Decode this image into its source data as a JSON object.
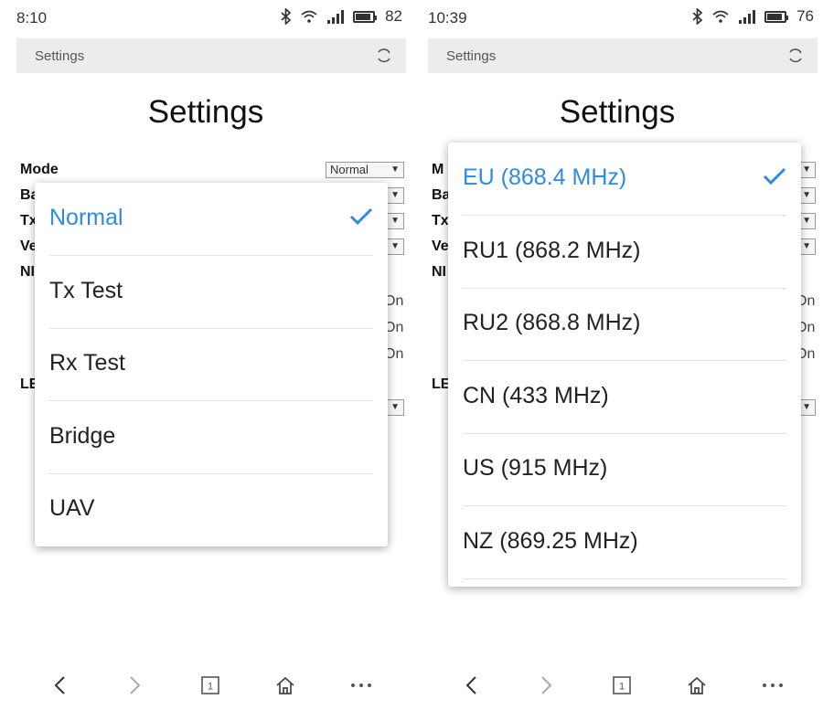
{
  "screens": [
    {
      "time": "8:10",
      "battery": "82",
      "address_title": "Settings",
      "page_title": "Settings",
      "labels": [
        "Mode",
        "Ba",
        "Tx",
        "Ve",
        "NI",
        "LE"
      ],
      "mode_select": "Normal",
      "right_fragments": [
        "On",
        "On",
        "On"
      ],
      "dropdown": {
        "options": [
          "Normal",
          "Tx Test",
          "Rx Test",
          "Bridge",
          "UAV"
        ],
        "selected": "Normal"
      }
    },
    {
      "time": "10:39",
      "battery": "76",
      "address_title": "Settings",
      "page_title": "Settings",
      "labels": [
        "M",
        "Ba",
        "Tx",
        "Ve",
        "NI",
        "LE"
      ],
      "right_fragments": [
        "On",
        "On",
        "On"
      ],
      "dropdown": {
        "options": [
          "EU (868.4 MHz)",
          "RU1 (868.2 MHz)",
          "RU2 (868.8 MHz)",
          "CN (433 MHz)",
          "US (915 MHz)",
          "NZ (869.25 MHz)"
        ],
        "selected": "EU (868.4 MHz)"
      }
    }
  ],
  "colors": {
    "accent": "#2e8be0",
    "text": "#222222",
    "address_bg": "#ececec"
  },
  "icons": [
    "bluetooth-icon",
    "wifi-icon",
    "signal-icon",
    "battery-icon",
    "refresh-icon",
    "checkmark-icon",
    "back-icon",
    "forward-icon",
    "tabs-icon",
    "home-icon",
    "more-icon"
  ]
}
